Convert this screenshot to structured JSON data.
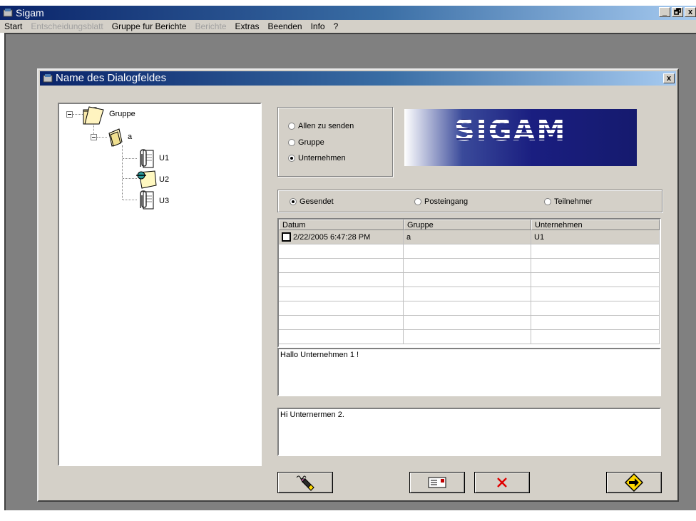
{
  "app": {
    "title": "Sigam",
    "window_buttons": [
      "_",
      "🗗",
      "x"
    ]
  },
  "menu": {
    "items": [
      {
        "label": "Start",
        "enabled": true
      },
      {
        "label": "Entscheidungsblatt",
        "enabled": false
      },
      {
        "label": "Gruppe fur Berichte",
        "enabled": true
      },
      {
        "label": "Berichte",
        "enabled": false
      },
      {
        "label": "Extras",
        "enabled": true
      },
      {
        "label": "Beenden",
        "enabled": true
      },
      {
        "label": "Info",
        "enabled": true
      },
      {
        "label": "?",
        "enabled": true
      }
    ]
  },
  "dialog": {
    "title": "Name des Dialogfeldes",
    "close_glyph": "x"
  },
  "tree": {
    "root": {
      "label": "Gruppe",
      "icon": "open-folder-icon"
    },
    "group": {
      "label": "a",
      "icon": "folder-icon"
    },
    "children": [
      {
        "label": "U1",
        "icon": "paperclip-icon"
      },
      {
        "label": "U2",
        "icon": "pinned-note-icon"
      },
      {
        "label": "U3",
        "icon": "paperclip-icon"
      }
    ]
  },
  "send_options": {
    "items": [
      "Allen zu senden",
      "Gruppe",
      "Unternehmen"
    ],
    "selected": "Unternehmen"
  },
  "logo": {
    "text": "SIGAM"
  },
  "folder_options": {
    "items": [
      "Gesendet",
      "Posteingang",
      "Teilnehmer"
    ],
    "selected": "Gesendet"
  },
  "grid": {
    "headers": [
      "Datum",
      "Gruppe",
      "Unternehmen"
    ],
    "rows": [
      {
        "datum": "2/22/2005 6:47:28 PM",
        "gruppe": "a",
        "unternehmen": "U1",
        "checked": false
      }
    ],
    "empty_rows": 7
  },
  "message_view": {
    "text": "Hallo Unternehmen 1 !"
  },
  "reply_input": {
    "text": "Hi Unternermen 2."
  },
  "buttons": {
    "compose_icon": "pen-icon",
    "message_icon": "letter-icon",
    "delete_icon": "red-x-icon",
    "next_icon": "arrow-right-icon"
  },
  "colors": {
    "titlebar_start": "#0a246a",
    "titlebar_end": "#a6caf0",
    "face": "#d4d0c8",
    "workspace": "#808080",
    "logo_bg": "#151a6e",
    "delete_red": "#e00000",
    "next_yellow": "#ffd800"
  }
}
